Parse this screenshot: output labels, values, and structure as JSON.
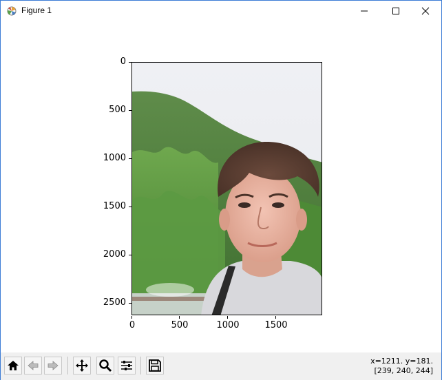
{
  "window": {
    "title": "Figure 1"
  },
  "axes": {
    "y_ticks": [
      "0",
      "500",
      "1000",
      "1500",
      "2000",
      "2500"
    ],
    "x_ticks": [
      "0",
      "500",
      "1000",
      "1500"
    ]
  },
  "image": {
    "description_icon": "photo-image"
  },
  "toolbar": {
    "buttons": [
      "home-icon",
      "back-icon",
      "forward-icon",
      "pan-icon",
      "zoom-icon",
      "configure-subplots-icon",
      "save-icon"
    ]
  },
  "status": {
    "coords": "x=1211. y=181.",
    "pixel": "[239, 240, 244]"
  },
  "colors": {
    "window_border": "#3a7bd5",
    "toolbar_bg": "#f0f0f0",
    "sky": "#eef0f4",
    "forest": "#4e8a3a"
  }
}
